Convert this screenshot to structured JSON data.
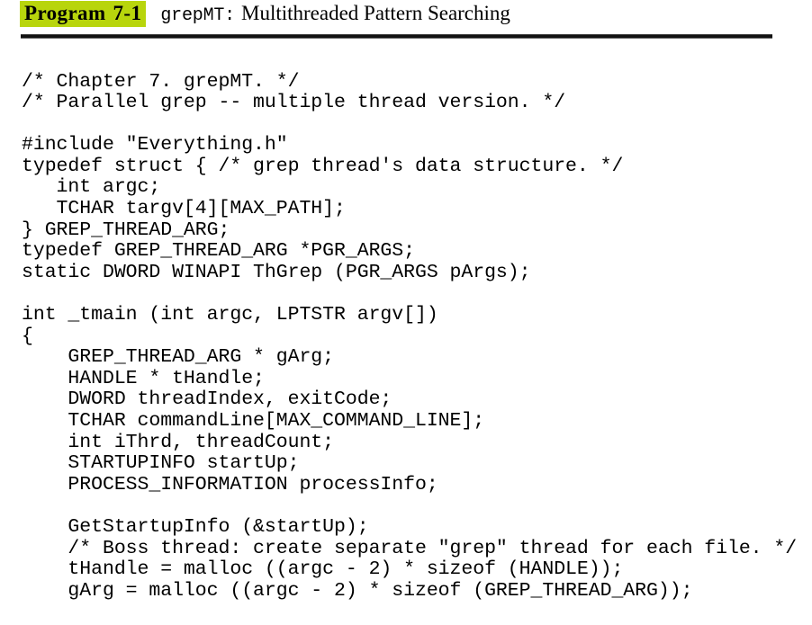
{
  "header": {
    "program_label": "Program",
    "program_number": "7-1",
    "program_name": "grepMT:",
    "title": "Multithreaded Pattern Searching",
    "highlight_color": "#b8d50c",
    "rule_color": "#111111"
  },
  "listing": {
    "language": "c",
    "lines": [
      "/* Chapter 7. grepMT. */",
      "/* Parallel grep -- multiple thread version. */",
      "",
      "#include \"Everything.h\"",
      "typedef struct { /* grep thread's data structure. */",
      "   int argc;",
      "   TCHAR targv[4][MAX_PATH];",
      "} GREP_THREAD_ARG;",
      "typedef GREP_THREAD_ARG *PGR_ARGS;",
      "static DWORD WINAPI ThGrep (PGR_ARGS pArgs);",
      "",
      "int _tmain (int argc, LPTSTR argv[])",
      "{",
      "    GREP_THREAD_ARG * gArg;",
      "    HANDLE * tHandle;",
      "    DWORD threadIndex, exitCode;",
      "    TCHAR commandLine[MAX_COMMAND_LINE];",
      "    int iThrd, threadCount;",
      "    STARTUPINFO startUp;",
      "    PROCESS_INFORMATION processInfo;",
      "",
      "    GetStartupInfo (&startUp);",
      "    /* Boss thread: create separate \"grep\" thread for each file. */",
      "    tHandle = malloc ((argc - 2) * sizeof (HANDLE));",
      "    gArg = malloc ((argc - 2) * sizeof (GREP_THREAD_ARG));"
    ]
  }
}
